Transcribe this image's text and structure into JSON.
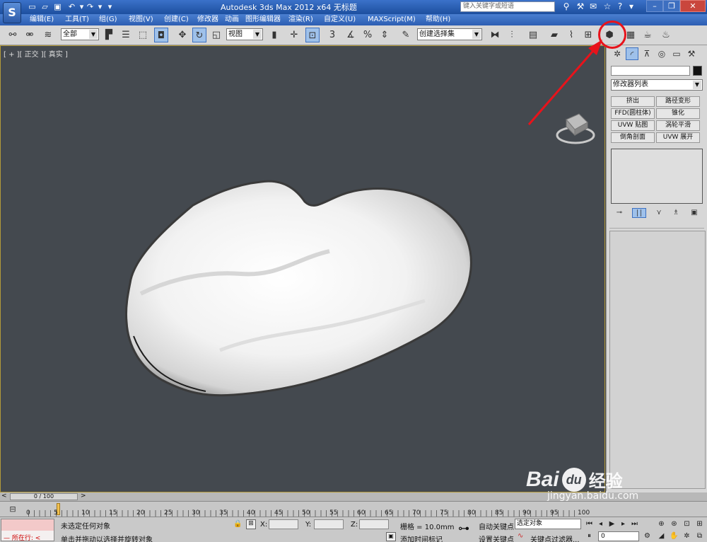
{
  "titlebar": {
    "app_title": "Autodesk 3ds Max  2012 x64      无标题",
    "search_placeholder": "键入关键字或短语"
  },
  "menu": [
    "编辑(E)",
    "工具(T)",
    "组(G)",
    "视图(V)",
    "创建(C)",
    "修改器",
    "动画",
    "图形编辑器",
    "渲染(R)",
    "自定义(U)",
    "MAXScript(M)",
    "帮助(H)"
  ],
  "toolbar": {
    "selection_filter": "全部",
    "ref_coord": "视图",
    "named_selection": "创建选择集",
    "snap_label": "3"
  },
  "viewport": {
    "label": "[ + ][ 正交 ][ 真实 ]"
  },
  "command_panel": {
    "modifier_list": "修改器列表",
    "modifier_buttons": [
      "挤出",
      "路径变形",
      "FFD(圆柱体)",
      "锥化",
      "UVW 贴图",
      "涡轮平滑",
      "倒角剖面",
      "UVW 展开"
    ]
  },
  "timeline": {
    "frame_readout": "0 / 100",
    "ticks": [
      "0",
      "5",
      "10",
      "15",
      "20",
      "25",
      "30",
      "35",
      "40",
      "45",
      "50",
      "55",
      "60",
      "65",
      "70",
      "75",
      "80",
      "85",
      "90",
      "95",
      "100"
    ]
  },
  "statusbar": {
    "maxscript_label": "所在行:",
    "status_line": "未选定任何对象",
    "prompt_line": "单击并拖动以选择并旋转对象",
    "x_label": "X:",
    "y_label": "Y:",
    "z_label": "Z:",
    "grid_label": "栅格 = 10.0mm",
    "add_time_tag": "添加时间标记",
    "auto_key": "自动关键点",
    "selected_object": "选定对象",
    "set_key": "设置关键点",
    "key_filters": "关键点过滤器...",
    "current_frame": "0"
  },
  "watermark": {
    "brand": "Bai",
    "brand_cn": "经验",
    "url": "jingyan.baidu.com"
  },
  "colors": {
    "annotation": "#e8131b",
    "viewport_bg": "#44494f",
    "title_blue": "#2c5eb2"
  }
}
